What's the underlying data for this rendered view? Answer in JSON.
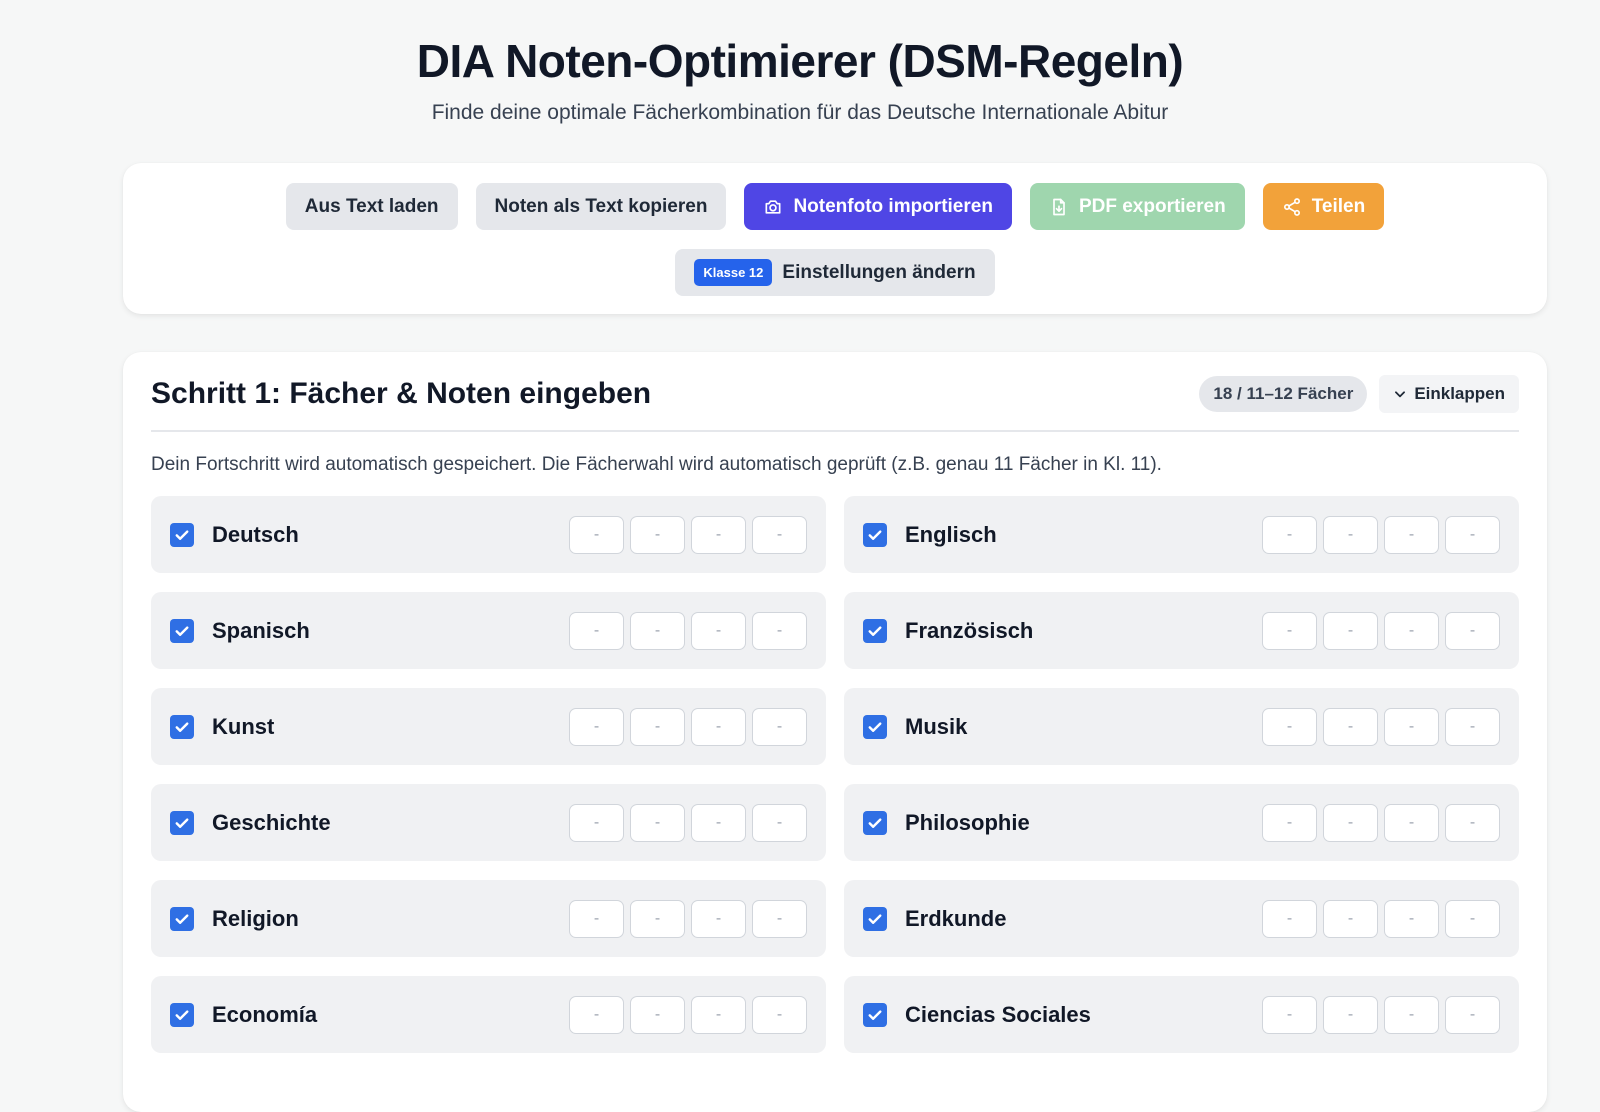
{
  "header": {
    "title": "DIA Noten-Optimierer (DSM-Regeln)",
    "subtitle": "Finde deine optimale Fächerkombination für das Deutsche Internationale Abitur"
  },
  "toolbar": {
    "load_text": "Aus Text laden",
    "copy_text": "Noten als Text kopieren",
    "import_photo": "Notenfoto importieren",
    "export_pdf": "PDF exportieren",
    "share": "Teilen",
    "class_badge": "Klasse 12",
    "settings": "Einstellungen ändern"
  },
  "step1": {
    "title": "Schritt 1: Fächer & Noten eingeben",
    "count": "18 / 11–12 Fächer",
    "collapse": "Einklappen",
    "hint": "Dein Fortschritt wird automatisch gespeichert. Die Fächerwahl wird automatisch geprüft (z.B. genau 11 Fächer in Kl. 11).",
    "subjects": [
      {
        "name": "Deutsch",
        "checked": true,
        "grades": [
          "-",
          "-",
          "-",
          "-"
        ]
      },
      {
        "name": "Englisch",
        "checked": true,
        "grades": [
          "-",
          "-",
          "-",
          "-"
        ]
      },
      {
        "name": "Spanisch",
        "checked": true,
        "grades": [
          "-",
          "-",
          "-",
          "-"
        ]
      },
      {
        "name": "Französisch",
        "checked": true,
        "grades": [
          "-",
          "-",
          "-",
          "-"
        ]
      },
      {
        "name": "Kunst",
        "checked": true,
        "grades": [
          "-",
          "-",
          "-",
          "-"
        ]
      },
      {
        "name": "Musik",
        "checked": true,
        "grades": [
          "-",
          "-",
          "-",
          "-"
        ]
      },
      {
        "name": "Geschichte",
        "checked": true,
        "grades": [
          "-",
          "-",
          "-",
          "-"
        ]
      },
      {
        "name": "Philosophie",
        "checked": true,
        "grades": [
          "-",
          "-",
          "-",
          "-"
        ]
      },
      {
        "name": "Religion",
        "checked": true,
        "grades": [
          "-",
          "-",
          "-",
          "-"
        ]
      },
      {
        "name": "Erdkunde",
        "checked": true,
        "grades": [
          "-",
          "-",
          "-",
          "-"
        ]
      },
      {
        "name": "Economía",
        "checked": true,
        "grades": [
          "-",
          "-",
          "-",
          "-"
        ]
      },
      {
        "name": "Ciencias Sociales",
        "checked": true,
        "grades": [
          "-",
          "-",
          "-",
          "-"
        ]
      }
    ]
  },
  "colors": {
    "primary": "#4f46e5",
    "checkbox": "#2f6fe4",
    "pdf": "#9fd6ae",
    "share": "#f2a23a",
    "badge": "#2563eb"
  }
}
